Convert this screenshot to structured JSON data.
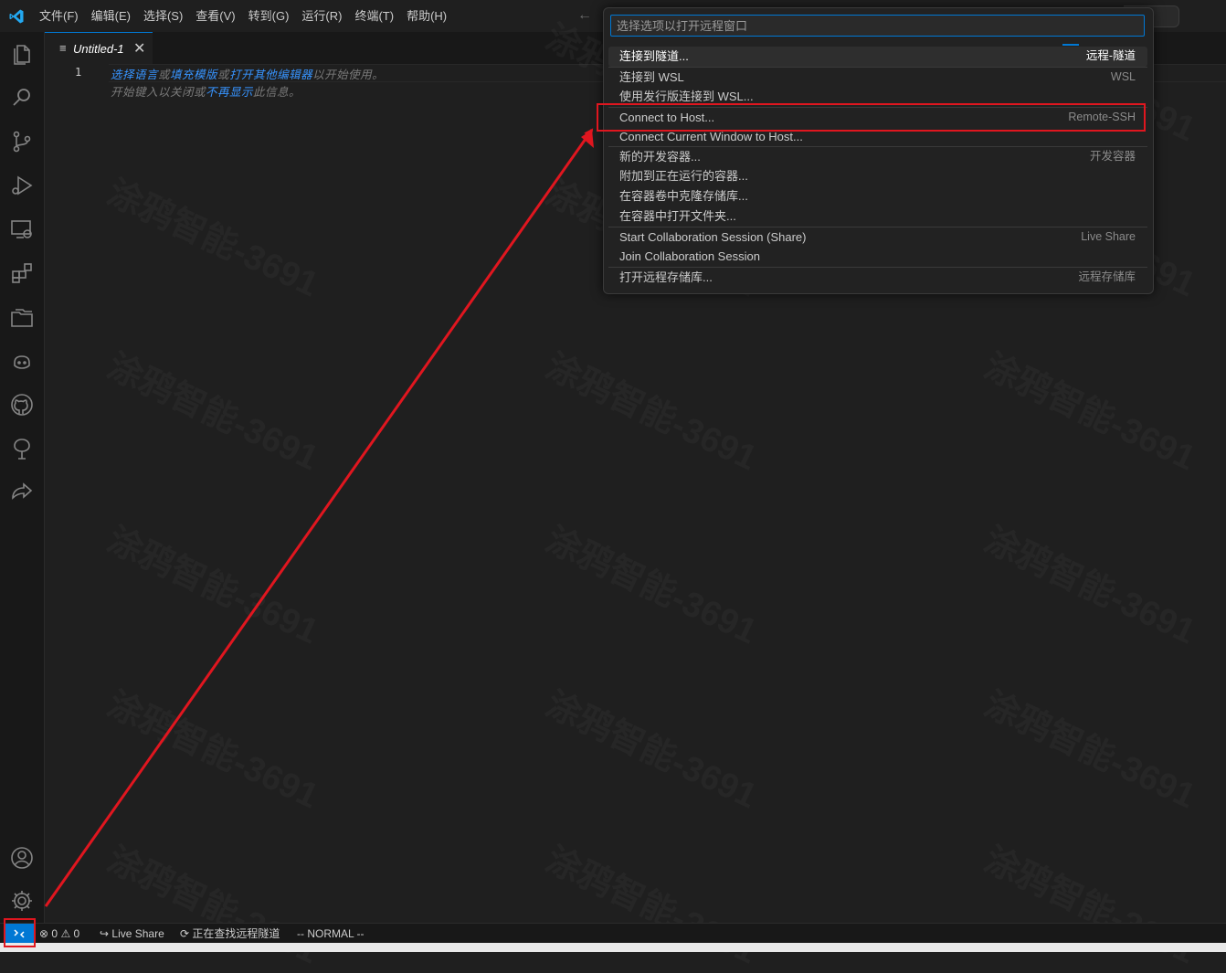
{
  "menu": [
    "文件(F)",
    "编辑(E)",
    "选择(S)",
    "查看(V)",
    "转到(G)",
    "运行(R)",
    "终端(T)",
    "帮助(H)"
  ],
  "activity_icons": [
    "explorer-icon",
    "search-icon",
    "source-control-icon",
    "run-debug-icon",
    "remote-explorer-icon",
    "extensions-icon",
    "file-folder-icon",
    "copilot-icon",
    "github-icon",
    "tree-icon",
    "live-share-icon"
  ],
  "tab": {
    "label": "Untitled-1",
    "icon": "≡",
    "close": "✕"
  },
  "editor": {
    "line_number": "1",
    "hint_line1": [
      {
        "text": "选择语言",
        "link": true
      },
      {
        "text": "或",
        "link": false
      },
      {
        "text": "填充模版",
        "link": true
      },
      {
        "text": "或",
        "link": false
      },
      {
        "text": "打开其他编辑器",
        "link": true
      },
      {
        "text": "以开始使用。",
        "link": false
      }
    ],
    "hint_line2": [
      {
        "text": "开始键入以关闭或",
        "link": false
      },
      {
        "text": "不再显示",
        "link": true
      },
      {
        "text": "此信息。",
        "link": false
      }
    ]
  },
  "quickpick": {
    "placeholder": "选择选项以打开远程窗口",
    "items": [
      {
        "label": "连接到隧道...",
        "desc": "远程-隧道",
        "selected": true,
        "sep": false
      },
      {
        "label": "连接到 WSL",
        "desc": "WSL",
        "selected": false,
        "sep": true
      },
      {
        "label": "使用发行版连接到 WSL...",
        "desc": "",
        "selected": false,
        "sep": false
      },
      {
        "label": "Connect to Host...",
        "desc": "Remote-SSH",
        "selected": false,
        "sep": true
      },
      {
        "label": "Connect Current Window to Host...",
        "desc": "",
        "selected": false,
        "sep": false
      },
      {
        "label": "新的开发容器...",
        "desc": "开发容器",
        "selected": false,
        "sep": true
      },
      {
        "label": "附加到正在运行的容器...",
        "desc": "",
        "selected": false,
        "sep": false
      },
      {
        "label": "在容器卷中克隆存储库...",
        "desc": "",
        "selected": false,
        "sep": false
      },
      {
        "label": "在容器中打开文件夹...",
        "desc": "",
        "selected": false,
        "sep": false
      },
      {
        "label": "Start Collaboration Session (Share)",
        "desc": "Live Share",
        "selected": false,
        "sep": true
      },
      {
        "label": "Join Collaboration Session",
        "desc": "",
        "selected": false,
        "sep": false
      },
      {
        "label": "打开远程存储库...",
        "desc": "远程存储库",
        "selected": false,
        "sep": true
      }
    ]
  },
  "statusbar": {
    "remote_icon": "><",
    "errors": "0",
    "warnings": "0",
    "live_share": "Live Share",
    "tunnel_status": "正在查找远程隧道",
    "vim_mode": "-- NORMAL --"
  },
  "watermark": "涂鸦智能-3691",
  "colors": {
    "accent": "#0078d4",
    "annotation_red": "#e0161f",
    "link": "#3794ff"
  }
}
